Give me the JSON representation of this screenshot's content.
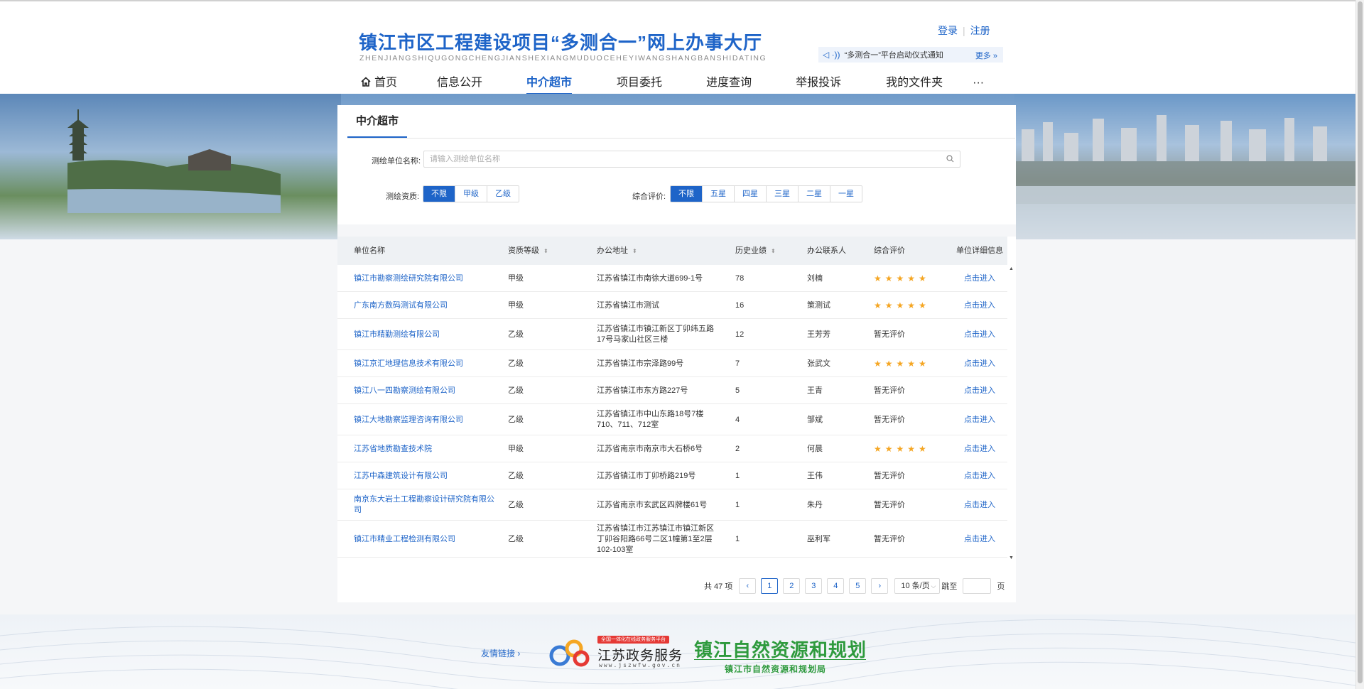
{
  "header": {
    "title": "镇江市区工程建设项目“多测合一”网上办事大厅",
    "pinyin": "ZHENJIANGSHIQUGONGCHENGJIANSHEXIANGMUDUOCEHEYIWANGSHANGBANSHIDATING",
    "login": "登录",
    "register": "注册",
    "notice": "“多测合一”平台启动仪式通知",
    "more": "更多 »"
  },
  "nav": {
    "items": [
      {
        "label": "首页",
        "icon": "home-icon"
      },
      {
        "label": "信息公开"
      },
      {
        "label": "中介超市",
        "active": true
      },
      {
        "label": "项目委托"
      },
      {
        "label": "进度查询"
      },
      {
        "label": "举报投诉"
      },
      {
        "label": "我的文件夹"
      },
      {
        "label": "···"
      }
    ]
  },
  "panel": {
    "title": "中介超市",
    "search_label": "测绘单位名称:",
    "search_placeholder": "请输入测绘单位名称",
    "qualification_label": "测绘资质:",
    "qualification_options": [
      "不限",
      "甲级",
      "乙级"
    ],
    "qualification_selected": "不限",
    "rating_label": "综合评价:",
    "rating_options": [
      "不限",
      "五星",
      "四星",
      "三星",
      "二星",
      "一星"
    ],
    "rating_selected": "不限"
  },
  "table": {
    "columns": [
      "单位名称",
      "资质等级",
      "办公地址",
      "历史业绩",
      "办公联系人",
      "综合评价",
      "单位详细信息"
    ],
    "sortable": [
      "资质等级",
      "办公地址",
      "历史业绩"
    ],
    "rows": [
      {
        "name": "镇江市勘察测绘研究院有限公司",
        "grade": "甲级",
        "address": "江苏省镇江市南徐大道699-1号",
        "performance": "78",
        "contact": "刘楠",
        "rating": 5,
        "rating_text": "",
        "detail": "点击进入"
      },
      {
        "name": "广东南方数码测试有限公司",
        "grade": "甲级",
        "address": "江苏省镇江市测试",
        "performance": "16",
        "contact": "策测试",
        "rating": 5,
        "rating_text": "",
        "detail": "点击进入"
      },
      {
        "name": "镇江市精勤测绘有限公司",
        "grade": "乙级",
        "address": "江苏省镇江市镇江新区丁卯纬五路17号马家山社区三楼",
        "performance": "12",
        "contact": "王芳芳",
        "rating": 0,
        "rating_text": "暂无评价",
        "detail": "点击进入"
      },
      {
        "name": "镇江京汇地理信息技术有限公司",
        "grade": "乙级",
        "address": "江苏省镇江市宗泽路99号",
        "performance": "7",
        "contact": "张武文",
        "rating": 5,
        "rating_text": "",
        "detail": "点击进入"
      },
      {
        "name": "镇江八一四勘察测绘有限公司",
        "grade": "乙级",
        "address": "江苏省镇江市东方路227号",
        "performance": "5",
        "contact": "王青",
        "rating": 0,
        "rating_text": "暂无评价",
        "detail": "点击进入"
      },
      {
        "name": "镇江大地勘察监理咨询有限公司",
        "grade": "乙级",
        "address": "江苏省镇江市中山东路18号7楼710、711、712室",
        "performance": "4",
        "contact": "邹斌",
        "rating": 0,
        "rating_text": "暂无评价",
        "detail": "点击进入"
      },
      {
        "name": "江苏省地质勘查技术院",
        "grade": "甲级",
        "address": "江苏省南京市南京市大石桥6号",
        "performance": "2",
        "contact": "何晨",
        "rating": 5,
        "rating_text": "",
        "detail": "点击进入"
      },
      {
        "name": "江苏中森建筑设计有限公司",
        "grade": "乙级",
        "address": "江苏省镇江市丁卯桥路219号",
        "performance": "1",
        "contact": "王伟",
        "rating": 0,
        "rating_text": "暂无评价",
        "detail": "点击进入"
      },
      {
        "name": "南京东大岩土工程勘察设计研究院有限公司",
        "grade": "乙级",
        "address": "江苏省南京市玄武区四牌楼61号",
        "performance": "1",
        "contact": "朱丹",
        "rating": 0,
        "rating_text": "暂无评价",
        "detail": "点击进入"
      },
      {
        "name": "镇江市精业工程检测有限公司",
        "grade": "乙级",
        "address": "江苏省镇江市江苏镇江市镇江新区丁卯谷阳路66号二区1幢第1至2层102-103室",
        "performance": "1",
        "contact": "巫利军",
        "rating": 0,
        "rating_text": "暂无评价",
        "detail": "点击进入"
      }
    ]
  },
  "pager": {
    "total": "共 47 项",
    "pages": [
      "1",
      "2",
      "3",
      "4",
      "5"
    ],
    "current": "1",
    "page_size": "10 条/页",
    "jump_label": "跳至",
    "page_unit": "页"
  },
  "footer": {
    "links_label": "友情链接 ›",
    "jiangsu_badge": "全国一体化在线政务服务平台",
    "jiangsu_title": "江苏政务服务",
    "jiangsu_url": "www.jszwfw.gov.cn",
    "zhenjiang_title": "镇江自然资源和规划",
    "zhenjiang_sub": "镇江市自然资源和规划局"
  },
  "colors": {
    "primary": "#1e64c8",
    "star": "#f5a623",
    "green": "#2e9a3d"
  }
}
